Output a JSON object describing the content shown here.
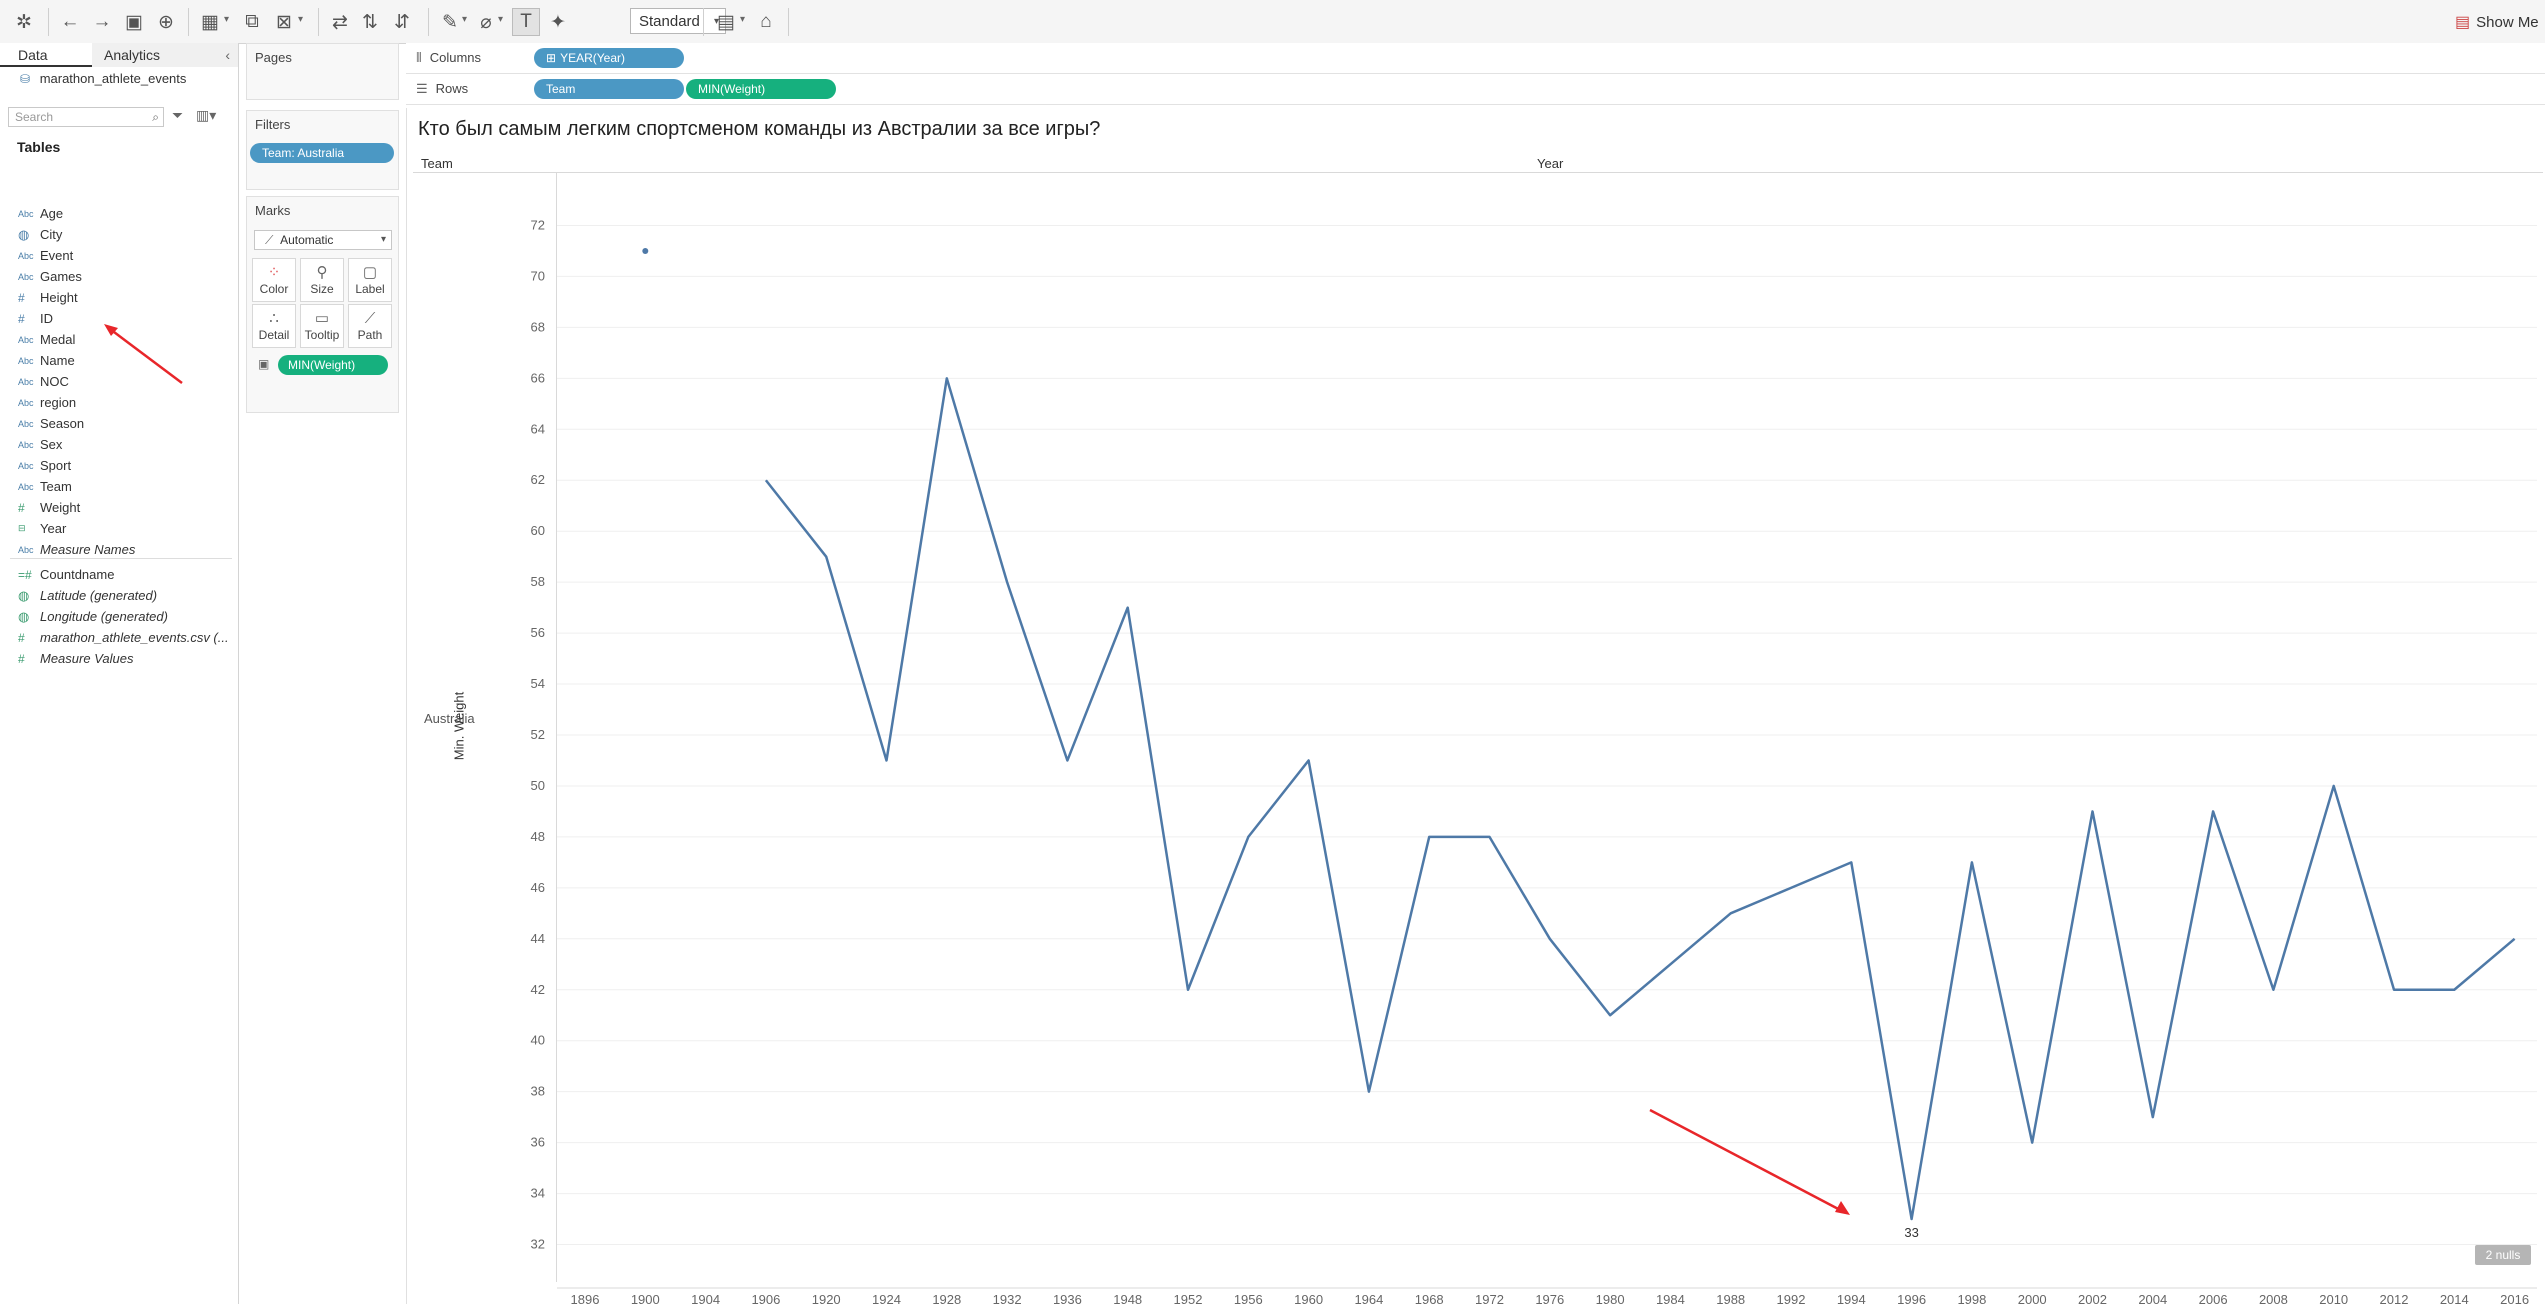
{
  "toolbar": {
    "view_mode": "Standard",
    "show_me_label": "Show Me"
  },
  "data_pane": {
    "tab_data": "Data",
    "tab_analytics": "Analytics",
    "datasource": "marathon_athlete_events",
    "search_placeholder": "Search",
    "tables_heading": "Tables",
    "fields": [
      {
        "icon": "Abc",
        "label": "Age"
      },
      {
        "icon": "globe",
        "label": "City"
      },
      {
        "icon": "Abc",
        "label": "Event"
      },
      {
        "icon": "Abc",
        "label": "Games"
      },
      {
        "icon": "#",
        "label": "Height"
      },
      {
        "icon": "#",
        "label": "ID"
      },
      {
        "icon": "Abc",
        "label": "Medal"
      },
      {
        "icon": "Abc",
        "label": "Name"
      },
      {
        "icon": "Abc",
        "label": "NOC"
      },
      {
        "icon": "Abc",
        "label": "region"
      },
      {
        "icon": "Abc",
        "label": "Season"
      },
      {
        "icon": "Abc",
        "label": "Sex"
      },
      {
        "icon": "Abc",
        "label": "Sport"
      },
      {
        "icon": "Abc",
        "label": "Team"
      },
      {
        "icon": "#",
        "label": "Weight"
      },
      {
        "icon": "date",
        "label": "Year"
      },
      {
        "icon": "Abc",
        "label": "Measure Names"
      },
      {
        "icon": "=#",
        "label": "Countdname"
      },
      {
        "icon": "globe",
        "label": "Latitude (generated)"
      },
      {
        "icon": "globe",
        "label": "Longitude (generated)"
      },
      {
        "icon": "#",
        "label": "marathon_athlete_events.csv (..."
      },
      {
        "icon": "#",
        "label": "Measure Values"
      }
    ]
  },
  "pages_card": {
    "title": "Pages"
  },
  "filters_card": {
    "title": "Filters",
    "filter": "Team: Australia"
  },
  "marks_card": {
    "title": "Marks",
    "mark_type": "Automatic",
    "buttons": [
      "Color",
      "Size",
      "Label",
      "Detail",
      "Tooltip",
      "Path"
    ],
    "pill": "MIN(Weight)"
  },
  "shelves": {
    "columns_label": "Columns",
    "columns_pill": "YEAR(Year)",
    "rows_label": "Rows",
    "rows_pill_1": "Team",
    "rows_pill_2": "MIN(Weight)"
  },
  "view": {
    "title": "Кто был самым легким спортсменом команды из Австралии за все игры?",
    "header_team": "Team",
    "header_year": "Year",
    "row_label": "Australia",
    "nulls_badge": "2 nulls"
  },
  "annotation_color": "#e8262a",
  "chart_data": {
    "type": "line",
    "ylabel": "Min. Weight",
    "ylim": [
      31,
      73
    ],
    "y_ticks": [
      32,
      34,
      36,
      38,
      40,
      42,
      44,
      46,
      48,
      50,
      52,
      54,
      56,
      58,
      60,
      62,
      64,
      66,
      68,
      70,
      72
    ],
    "categories": [
      "1896",
      "1900",
      "1904",
      "1906",
      "1920",
      "1924",
      "1928",
      "1932",
      "1936",
      "1948",
      "1952",
      "1956",
      "1960",
      "1964",
      "1968",
      "1972",
      "1976",
      "1980",
      "1984",
      "1988",
      "1992",
      "1994",
      "1996",
      "1998",
      "2000",
      "2002",
      "2004",
      "2006",
      "2008",
      "2010",
      "2012",
      "2014",
      "2016"
    ],
    "series": [
      {
        "values": [
          null,
          71,
          null,
          62,
          59,
          51,
          66,
          58,
          51,
          57,
          42,
          48,
          51,
          38,
          48,
          48,
          44,
          41,
          43,
          45,
          46,
          47,
          33,
          47,
          36,
          49,
          37,
          49,
          42,
          50,
          42,
          42,
          44
        ],
        "color": "#4e79a7"
      }
    ],
    "data_labels": [
      {
        "category": "1996",
        "value": 33,
        "text": "33"
      }
    ]
  }
}
